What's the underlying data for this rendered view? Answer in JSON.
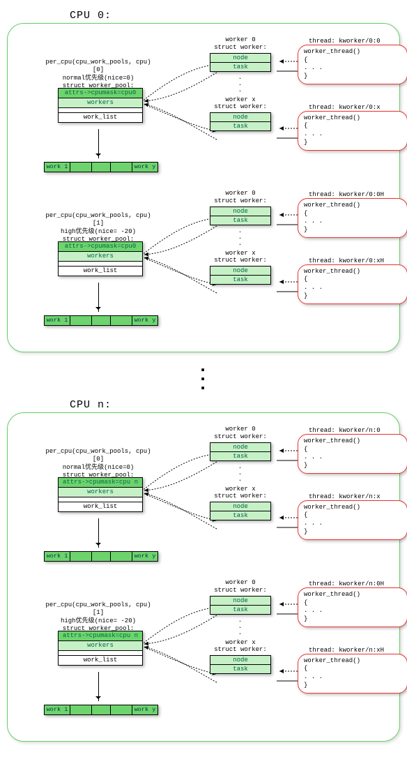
{
  "cpus": [
    {
      "title": "CPU 0:",
      "cpu_id": "0"
    },
    {
      "title": "CPU n:",
      "cpu_id": "n"
    }
  ],
  "pool": {
    "normal": {
      "hdr1": "per_cpu(cpu_work_pools, cpu)[0]",
      "hdr2": "normal优先级(nice=0)",
      "hdr3": "struct worker_pool:"
    },
    "high": {
      "hdr1": "per_cpu(cpu_work_pools, cpu)[1]",
      "hdr2": "high优先级(nice= -20)",
      "hdr3": "struct worker_pool:"
    },
    "attrs_prefix": "attrs->cpumask=cpu",
    "workers": "workers",
    "work_list": "work_list"
  },
  "worklist": {
    "first": "work 1",
    "last": "work y"
  },
  "worker": {
    "lbl0": "worker 0",
    "lblx": "worker x",
    "struct": "struct worker:",
    "node": "node",
    "task": "task"
  },
  "thread": {
    "prefix": "thread: kworker/",
    "fn": "worker_thread()",
    "brace_open": "{",
    "dots": "    . . .",
    "brace_close": "}"
  },
  "suffix": {
    "normal": {
      "w0": ":0",
      "wx": ":x"
    },
    "high": {
      "w0": ":0H",
      "wx": ":xH"
    }
  }
}
